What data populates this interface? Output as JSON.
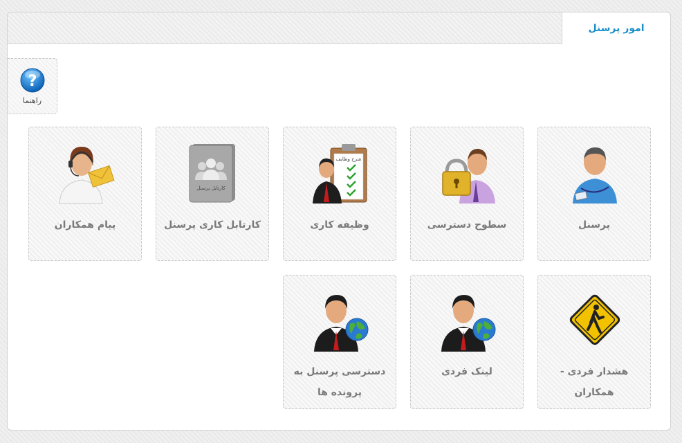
{
  "panel": {
    "tab_title": "امور پرسنل"
  },
  "help": {
    "label": "راهنما",
    "icon_glyph": "?"
  },
  "tiles": [
    {
      "label": "پرسنل",
      "icon": "personnel-icon"
    },
    {
      "label": "سطوح دسترسی",
      "icon": "lock-user-icon"
    },
    {
      "label": "وظیفه کاری",
      "icon": "task-clipboard-icon",
      "icon_caption": "شرح وظایف"
    },
    {
      "label": "کارتابل کاری پرسنل",
      "icon": "cartable-folder-icon",
      "icon_caption": "کارتابل پرسنل"
    },
    {
      "label": "پیام همکاران",
      "icon": "support-mail-icon"
    },
    {
      "label": "هشدار فردی - همکاران",
      "icon": "warning-sign-icon"
    },
    {
      "label": "لینک فردی",
      "icon": "user-globe-icon"
    },
    {
      "label": "دسترسی پرسنل به پرونده ها",
      "icon": "user-globe-icon"
    }
  ],
  "colors": {
    "accent": "#1a8fc9",
    "tile_text": "#7a7a7a"
  }
}
